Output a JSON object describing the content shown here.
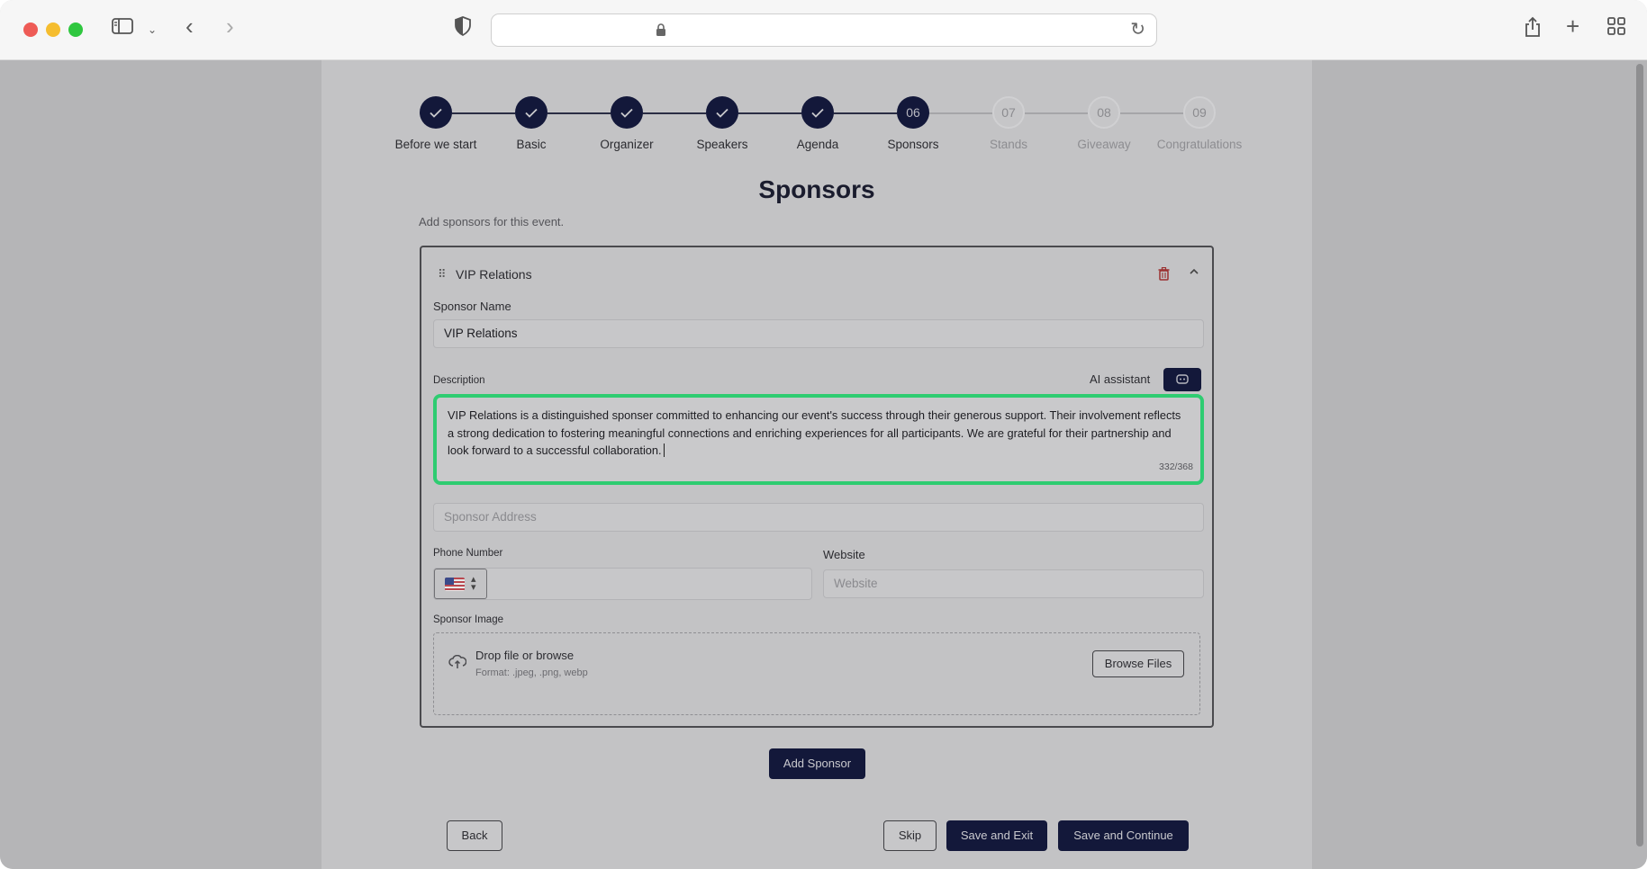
{
  "browser": {
    "address": ""
  },
  "stepper": {
    "steps": [
      {
        "label": "Before we start",
        "number": "",
        "state": "done"
      },
      {
        "label": "Basic",
        "number": "",
        "state": "done"
      },
      {
        "label": "Organizer",
        "number": "",
        "state": "done"
      },
      {
        "label": "Speakers",
        "number": "",
        "state": "done"
      },
      {
        "label": "Agenda",
        "number": "",
        "state": "done"
      },
      {
        "label": "Sponsors",
        "number": "06",
        "state": "current"
      },
      {
        "label": "Stands",
        "number": "07",
        "state": "todo"
      },
      {
        "label": "Giveaway",
        "number": "08",
        "state": "todo"
      },
      {
        "label": "Congratulations",
        "number": "09",
        "state": "todo"
      }
    ]
  },
  "page": {
    "title": "Sponsors",
    "subtitle": "Add sponsors for this event."
  },
  "sponsor_card": {
    "title": "VIP Relations",
    "name_label": "Sponsor Name",
    "name_value": "VIP Relations",
    "description_label": "Description",
    "ai_assistant_label": "AI assistant",
    "description_value": "VIP Relations is a distinguished sponser committed to enhancing our event's success through their generous support. Their involvement reflects a strong dedication to fostering meaningful connections and enriching experiences for all participants. We are grateful for their partnership and look forward to a successful collaboration.",
    "description_counter": "332/368",
    "address_placeholder": "Sponsor Address",
    "phone_label": "Phone Number",
    "website_label": "Website",
    "website_placeholder": "Website",
    "image_label": "Sponsor Image",
    "drop_title": "Drop file or browse",
    "drop_format": "Format: .jpeg, .png, webp",
    "browse_label": "Browse Files"
  },
  "actions": {
    "add_sponsor": "Add Sponsor",
    "back": "Back",
    "skip": "Skip",
    "save_exit": "Save and Exit",
    "save_continue": "Save and Continue"
  },
  "colors": {
    "primary": "#13183a",
    "highlight": "#2ecc71",
    "delete": "#9b3030"
  }
}
